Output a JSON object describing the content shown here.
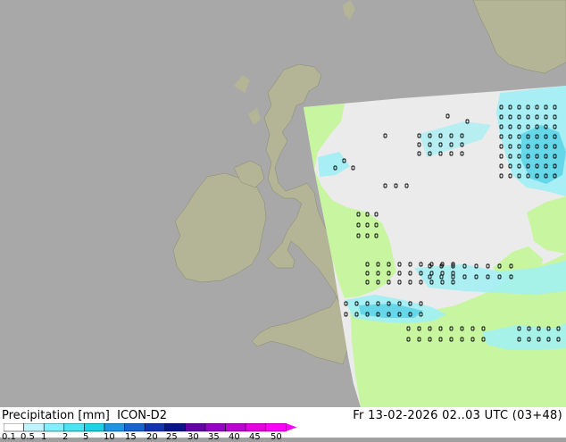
{
  "header": {
    "title": "Precipitation [mm]",
    "model": "ICON-D2",
    "valid_time": "Fr 13-02-2026 02..03 UTC (03+48)"
  },
  "legend": {
    "tick_labels": [
      "0.1",
      "0.5",
      "1",
      "2",
      "5",
      "10",
      "15",
      "20",
      "25",
      "30",
      "35",
      "40",
      "45",
      "50"
    ],
    "colors": [
      "#ffffff",
      "#bff5ff",
      "#7ff0ff",
      "#46e6f5",
      "#1ed2e6",
      "#1e96e6",
      "#1464d2",
      "#1432b4",
      "#0a148c",
      "#6400aa",
      "#9600c8",
      "#be00d2",
      "#e600e6",
      "#ff00ff"
    ]
  },
  "map_colors": {
    "sea": "#a8a8a8",
    "land_outside": "#b4b496",
    "domain_sea": "#ebebeb",
    "domain_land": "#c8f5a0",
    "precip_light": "#a0f0f5",
    "precip_mid": "#5ad2e6",
    "precip_blue": "#3c96dc"
  }
}
